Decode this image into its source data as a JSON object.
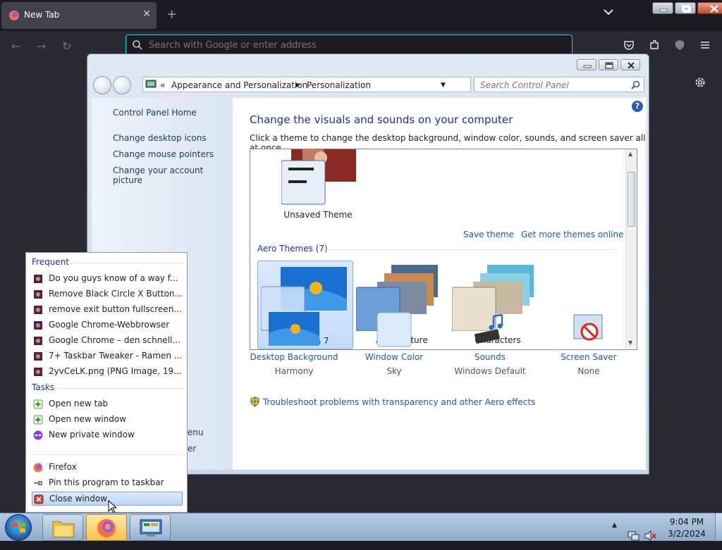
{
  "browser": {
    "tab_title": "New Tab",
    "url_placeholder": "Search with Google or enter address",
    "tab_close": "✕",
    "new_tab": "+"
  },
  "control_panel": {
    "breadcrumb_chevrons": "«",
    "breadcrumb": [
      "Appearance and Personalization",
      "Personalization"
    ],
    "search_placeholder": "Search Control Panel",
    "sidebar": {
      "home": "Control Panel Home",
      "links": [
        "Change desktop icons",
        "Change mouse pointers",
        "Change your account picture"
      ],
      "partial_links": [
        "enu",
        "er"
      ]
    },
    "title": "Change the visuals and sounds on your computer",
    "subtitle": "Click a theme to change the desktop background, window color, sounds, and screen saver all at once.",
    "unsaved_theme": "Unsaved Theme",
    "save_theme": "Save theme",
    "get_more_themes": "Get more themes online",
    "aero_section": "Aero Themes (7)",
    "themes": [
      "Windows 7",
      "Architecture",
      "Characters"
    ],
    "bottom_items": [
      {
        "label": "Desktop Background",
        "value": "Harmony"
      },
      {
        "label": "Window Color",
        "value": "Sky"
      },
      {
        "label": "Sounds",
        "value": "Windows Default"
      },
      {
        "label": "Screen Saver",
        "value": "None"
      }
    ],
    "troubleshoot": "Troubleshoot problems with transparency and other Aero effects",
    "help": "?"
  },
  "jumplist": {
    "frequent_header": "Frequent",
    "frequent": [
      "Do you guys know of a way f...",
      "Remove Black Circle X Button...",
      "remove exit button fullscreen...",
      "Google Chrome-Webbrowser",
      "Google Chrome – den schnell...",
      "7+ Taskbar Tweaker - Ramen ...",
      "2yvCeLK.png (PNG Image, 19..."
    ],
    "tasks_header": "Tasks",
    "tasks": [
      "Open new tab",
      "Open new window",
      "New private window"
    ],
    "app_items": [
      "Firefox",
      "Pin this program to taskbar",
      "Close window"
    ]
  },
  "taskbar": {
    "time": "9:04 PM",
    "date": "3/2/2024"
  },
  "colors": {
    "accent_link": "#1e5aa8",
    "heading": "#1e3287",
    "firefox_urlbar_focus": "#00ddff"
  }
}
